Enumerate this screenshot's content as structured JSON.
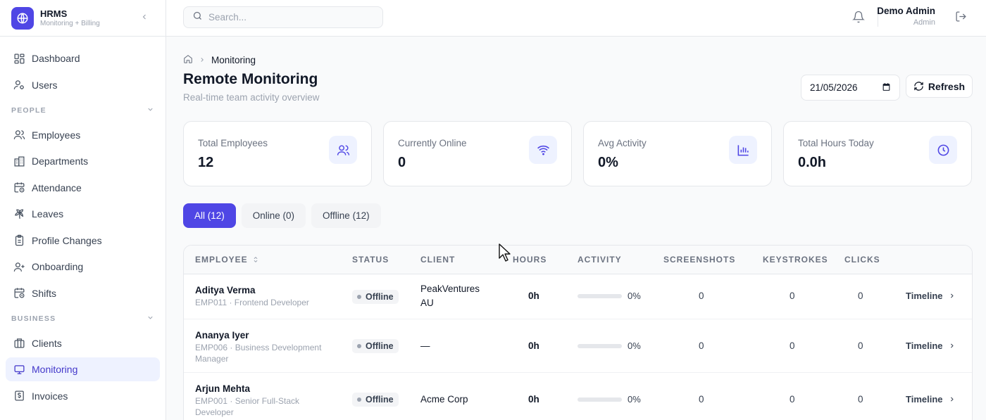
{
  "brand": {
    "title": "HRMS",
    "subtitle": "Monitoring + Billing"
  },
  "sidebar": {
    "top_items": [
      {
        "label": "Dashboard",
        "icon": "dashboard-icon"
      },
      {
        "label": "Users",
        "icon": "users-icon"
      }
    ],
    "sections": [
      {
        "label": "PEOPLE",
        "items": [
          {
            "label": "Employees",
            "icon": "employees-icon"
          },
          {
            "label": "Departments",
            "icon": "building-icon"
          },
          {
            "label": "Attendance",
            "icon": "calendar-clock-icon"
          },
          {
            "label": "Leaves",
            "icon": "palm-tree-icon"
          },
          {
            "label": "Profile Changes",
            "icon": "clipboard-icon"
          },
          {
            "label": "Onboarding",
            "icon": "user-plus-icon"
          },
          {
            "label": "Shifts",
            "icon": "calendar-clock-icon"
          }
        ]
      },
      {
        "label": "BUSINESS",
        "items": [
          {
            "label": "Clients",
            "icon": "briefcase-icon"
          },
          {
            "label": "Monitoring",
            "icon": "monitor-icon",
            "active": true
          },
          {
            "label": "Invoices",
            "icon": "dollar-receipt-icon"
          }
        ]
      }
    ]
  },
  "topbar": {
    "search_placeholder": "Search...",
    "user_name": "Demo Admin",
    "user_role": "Admin"
  },
  "page": {
    "breadcrumb": "Monitoring",
    "title": "Remote Monitoring",
    "subtitle": "Real-time team activity overview",
    "date": "21/05/2026",
    "refresh_label": "Refresh"
  },
  "stats": [
    {
      "label": "Total Employees",
      "value": "12",
      "icon": "users-icon"
    },
    {
      "label": "Currently Online",
      "value": "0",
      "icon": "wifi-icon"
    },
    {
      "label": "Avg Activity",
      "value": "0%",
      "icon": "bar-chart-icon"
    },
    {
      "label": "Total Hours Today",
      "value": "0.0h",
      "icon": "clock-icon"
    }
  ],
  "filters": [
    {
      "label": "All (12)",
      "active": true
    },
    {
      "label": "Online (0)"
    },
    {
      "label": "Offline (12)"
    }
  ],
  "table": {
    "columns": [
      "EMPLOYEE",
      "STATUS",
      "CLIENT",
      "HOURS",
      "ACTIVITY",
      "SCREENSHOTS",
      "KEYSTROKES",
      "CLICKS"
    ],
    "timeline_label": "Timeline",
    "rows": [
      {
        "name": "Aditya Verma",
        "meta": "EMP011 · Frontend Developer",
        "status": "Offline",
        "client": "PeakVentures AU",
        "hours": "0h",
        "activity": 0,
        "activity_label": "0%",
        "screenshots": "0",
        "keystrokes": "0",
        "clicks": "0"
      },
      {
        "name": "Ananya Iyer",
        "meta": "EMP006 · Business Development Manager",
        "status": "Offline",
        "client": "—",
        "hours": "0h",
        "activity": 0,
        "activity_label": "0%",
        "screenshots": "0",
        "keystrokes": "0",
        "clicks": "0"
      },
      {
        "name": "Arjun Mehta",
        "meta": "EMP001 · Senior Full-Stack Developer",
        "status": "Offline",
        "client": "Acme Corp",
        "hours": "0h",
        "activity": 0,
        "activity_label": "0%",
        "screenshots": "0",
        "keystrokes": "0",
        "clicks": "0"
      }
    ]
  },
  "colors": {
    "accent": "#4f46e5",
    "accent_soft": "#eef2ff",
    "muted": "#9ca3af",
    "border": "#e5e7eb"
  }
}
